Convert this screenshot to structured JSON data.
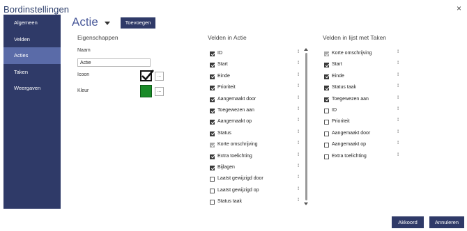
{
  "window": {
    "title": "Bordinstellingen",
    "close_glyph": "×"
  },
  "sidebar": {
    "items": [
      {
        "label": "Algemeen"
      },
      {
        "label": "Velden"
      },
      {
        "label": "Acties"
      },
      {
        "label": "Taken"
      },
      {
        "label": "Weergaven"
      }
    ],
    "active": "Acties"
  },
  "header": {
    "title": "Actie",
    "add_label": "Toevoegen"
  },
  "properties": {
    "title": "Eigenschappen",
    "name_label": "Naam",
    "name_value": "Actie",
    "icon_label": "Icoon",
    "icon_name": "checkmark-icon",
    "color_label": "Kleur",
    "color_value": "#1a8a28",
    "browse_label": "..."
  },
  "fields_action": {
    "title": "Velden in Actie",
    "items": [
      {
        "label": "ID",
        "checked": true,
        "disabled": false
      },
      {
        "label": "Start",
        "checked": true,
        "disabled": false
      },
      {
        "label": "Einde",
        "checked": true,
        "disabled": false
      },
      {
        "label": "Prioriteit",
        "checked": true,
        "disabled": false
      },
      {
        "label": "Aangemaakt door",
        "checked": true,
        "disabled": false
      },
      {
        "label": "Toegewezen aan",
        "checked": true,
        "disabled": false
      },
      {
        "label": "Aangemaakt op",
        "checked": true,
        "disabled": false
      },
      {
        "label": "Status",
        "checked": true,
        "disabled": false
      },
      {
        "label": "Korte omschrijving",
        "checked": true,
        "disabled": true
      },
      {
        "label": "Extra toelichting",
        "checked": true,
        "disabled": false
      },
      {
        "label": "Bijlagen",
        "checked": true,
        "disabled": false
      },
      {
        "label": "Laatst gewijzigd door",
        "checked": false,
        "disabled": false
      },
      {
        "label": "Laatst gewijzigd op",
        "checked": false,
        "disabled": false
      },
      {
        "label": "Status taak",
        "checked": false,
        "disabled": false
      }
    ]
  },
  "fields_tasks": {
    "title": "Velden in lijst met Taken",
    "items": [
      {
        "label": "Korte omschrijving",
        "checked": true,
        "disabled": true
      },
      {
        "label": "Start",
        "checked": true,
        "disabled": false
      },
      {
        "label": "Einde",
        "checked": true,
        "disabled": false
      },
      {
        "label": "Status taak",
        "checked": true,
        "disabled": false
      },
      {
        "label": "Toegewezen aan",
        "checked": true,
        "disabled": false
      },
      {
        "label": "ID",
        "checked": false,
        "disabled": false
      },
      {
        "label": "Prioriteit",
        "checked": false,
        "disabled": false
      },
      {
        "label": "Aangemaakt door",
        "checked": false,
        "disabled": false
      },
      {
        "label": "Aangemaakt op",
        "checked": false,
        "disabled": false
      },
      {
        "label": "Extra toelichting",
        "checked": false,
        "disabled": false
      }
    ]
  },
  "footer": {
    "ok_label": "Akkoord",
    "cancel_label": "Annuleren"
  },
  "colors": {
    "primary": "#2f3a68",
    "active_nav": "#5a6ba8",
    "header_text": "#4a5a9a"
  }
}
